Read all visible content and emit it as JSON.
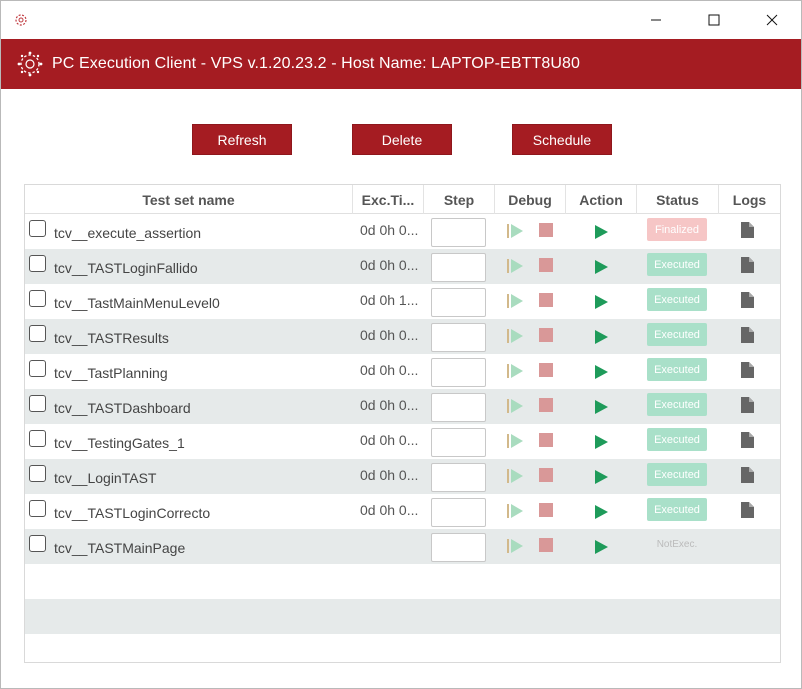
{
  "window": {
    "buttons": [
      "minimize",
      "maximize",
      "close"
    ]
  },
  "header": {
    "title": "PC Execution Client - VPS v.1.20.23.2 - Host Name: LAPTOP-EBTT8U80"
  },
  "toolbar": {
    "refresh_label": "Refresh",
    "delete_label": "Delete",
    "schedule_label": "Schedule"
  },
  "table": {
    "columns": {
      "name": "Test set name",
      "time": "Exc.Ti...",
      "step": "Step",
      "debug": "Debug",
      "action": "Action",
      "status": "Status",
      "logs": "Logs"
    },
    "rows": [
      {
        "name": "tcv__execute_assertion",
        "time": "0d 0h 0...",
        "status": "Finalized"
      },
      {
        "name": "tcv__TASTLoginFallido",
        "time": "0d 0h 0...",
        "status": "Executed"
      },
      {
        "name": "tcv__TastMainMenuLevel0",
        "time": "0d 0h 1...",
        "status": "Executed"
      },
      {
        "name": "tcv__TASTResults",
        "time": "0d 0h 0...",
        "status": "Executed"
      },
      {
        "name": "tcv__TastPlanning",
        "time": "0d 0h 0...",
        "status": "Executed"
      },
      {
        "name": "tcv__TASTDashboard",
        "time": "0d 0h 0...",
        "status": "Executed"
      },
      {
        "name": "tcv__TestingGates_1",
        "time": "0d 0h 0...",
        "status": "Executed"
      },
      {
        "name": "tcv__LoginTAST",
        "time": "0d 0h 0...",
        "status": "Executed"
      },
      {
        "name": "tcv__TASTLoginCorrecto",
        "time": "0d 0h 0...",
        "status": "Executed"
      },
      {
        "name": "tcv__TASTMainPage",
        "time": "",
        "status": "NotExec."
      }
    ]
  },
  "colors": {
    "brand": "#a51c22",
    "executed": "#a9e0c9",
    "finalized": "#f6c6c6",
    "run_icon": "#1e9b5a",
    "debug_stop": "#d99898",
    "row_alt": "#e6eaea"
  },
  "icons": {
    "app": "virus-logo-icon",
    "debug_play": "step-play-icon",
    "debug_stop": "stop-icon",
    "run": "play-icon",
    "log": "document-icon"
  }
}
